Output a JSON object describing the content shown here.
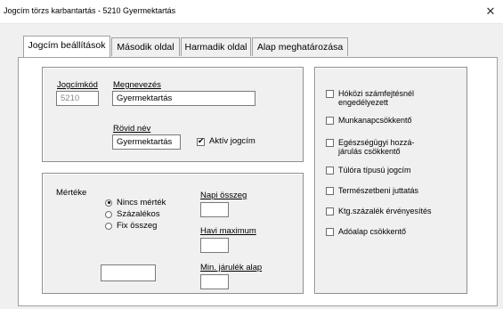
{
  "window": {
    "title": "Jogcím törzs karbantartás - 5210 Gyermektartás"
  },
  "tabs": [
    {
      "label": "Jogcím beállítások"
    },
    {
      "label": "Második oldal"
    },
    {
      "label": "Harmadik oldal"
    },
    {
      "label": "Alap meghatározása"
    }
  ],
  "general": {
    "code_label": "Jogcímkód",
    "code_value": "5210",
    "name_label": "Megnevezés",
    "name_value": "Gyermektartás",
    "short_label": "Rövid név",
    "short_value": "Gyermektartás",
    "active_label": "Aktív jogcím",
    "active_checked": true
  },
  "measure": {
    "label": "Mértéke",
    "options": [
      "Nincs mérték",
      "Százalékos",
      "Fix összeg"
    ],
    "selected": "Nincs mérték",
    "daily_label": "Napi összeg",
    "monthly_label": "Havi maximum",
    "min_label": "Min. járulék alap"
  },
  "flags": [
    {
      "label": "Hóközi számfejtésnél engedélyezett",
      "checked": false
    },
    {
      "label": "Munkanapcsökkentő",
      "checked": false
    },
    {
      "label": "Egészségügyi hozzá-járulás csökkentő",
      "checked": false
    },
    {
      "label": "Túlóra típusú jogcím",
      "checked": false
    },
    {
      "label": "Természetbeni juttatás",
      "checked": false
    },
    {
      "label": "Ktg.százalék érvényesítés",
      "checked": false
    },
    {
      "label": "Adóalap csökkentő",
      "checked": false
    }
  ]
}
